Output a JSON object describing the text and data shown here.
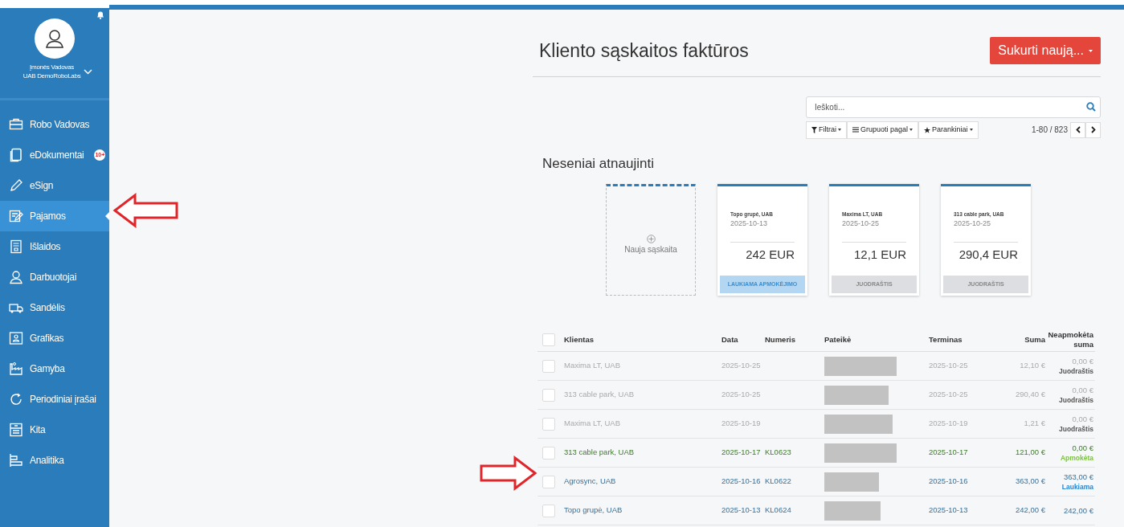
{
  "sidebar": {
    "user": {
      "name": "Įmonės Vadovas",
      "company": "UAB DemoRoboLabs"
    },
    "items": [
      {
        "label": "Robo Vadovas",
        "selected": false
      },
      {
        "label": "eDokumentai",
        "selected": false,
        "badge": "10+"
      },
      {
        "label": "eSign",
        "selected": false
      },
      {
        "label": "Pajamos",
        "selected": true
      },
      {
        "label": "Išlaidos",
        "selected": false
      },
      {
        "label": "Darbuotojai",
        "selected": false
      },
      {
        "label": "Sandėlis",
        "selected": false
      },
      {
        "label": "Grafikas",
        "selected": false
      },
      {
        "label": "Gamyba",
        "selected": false
      },
      {
        "label": "Periodiniai įrašai",
        "selected": false
      },
      {
        "label": "Kita",
        "selected": false
      },
      {
        "label": "Analitika",
        "selected": false
      }
    ]
  },
  "header": {
    "title": "Kliento sąskaitos faktūros",
    "create_button": "Sukurti naują...",
    "search": {
      "placeholder": "Ieškoti..."
    },
    "filters": [
      {
        "label": "Filtrai"
      },
      {
        "label": "Grupuoti pagal"
      },
      {
        "label": "Parankiniai"
      }
    ],
    "pager": "1-80 / 823"
  },
  "recent": {
    "title": "Neseniai atnaujinti",
    "new_card": "Nauja sąskaita",
    "cards": [
      {
        "client": "Topo grupė, UAB",
        "date": "2025-10-13",
        "amount": "242 EUR",
        "status": "LAUKIAMA APMOKĖJIMO",
        "kind": "waiting"
      },
      {
        "client": "Maxima LT, UAB",
        "date": "2025-10-25",
        "amount": "12,1 EUR",
        "status": "JUODRAŠTIS",
        "kind": "draft"
      },
      {
        "client": "313 cable park, UAB",
        "date": "2025-10-25",
        "amount": "290,4 EUR",
        "status": "JUODRAŠTIS",
        "kind": "draft"
      }
    ]
  },
  "table": {
    "all_checked": false,
    "columns": [
      "Klientas",
      "Data",
      "Numeris",
      "Pateikė",
      "Terminas",
      "Suma",
      "Neapmokėta suma"
    ],
    "rows": [
      {
        "kind": "draft",
        "checked": false,
        "client": "Maxima LT, UAB",
        "date": "2025-10-25",
        "due": "2025-10-25",
        "sum": "12,10 €",
        "unpaid": "0,00 €",
        "status": "Juodraštis"
      },
      {
        "kind": "draft",
        "checked": false,
        "client": "313 cable park, UAB",
        "date": "2025-10-25",
        "due": "2025-10-25",
        "sum": "290,40 €",
        "unpaid": "0,00 €",
        "status": "Juodraštis"
      },
      {
        "kind": "draft",
        "checked": false,
        "client": "Maxima LT, UAB",
        "date": "2025-10-19",
        "due": "2025-10-19",
        "sum": "1,21 €",
        "unpaid": "0,00 €",
        "status": "Juodraštis"
      },
      {
        "kind": "paid",
        "checked": false,
        "client": "313 cable park, UAB",
        "date": "2025-10-17",
        "number": "KL0623",
        "due": "2025-10-17",
        "sum": "121,00 €",
        "unpaid": "0,00 €",
        "status": "Apmokėta"
      },
      {
        "kind": "waiting",
        "checked": false,
        "client": "Agrosync, UAB",
        "date": "2025-10-16",
        "number": "KL0622",
        "due": "2025-10-16",
        "sum": "363,00 €",
        "unpaid": "363,00 €",
        "status": "Laukiama"
      },
      {
        "kind": "waiting",
        "checked": false,
        "client": "Topo grupė, UAB",
        "date": "2025-10-13",
        "number": "KL0624",
        "due": "2025-10-13",
        "sum": "242,00 €",
        "unpaid": "242,00 €"
      }
    ]
  }
}
